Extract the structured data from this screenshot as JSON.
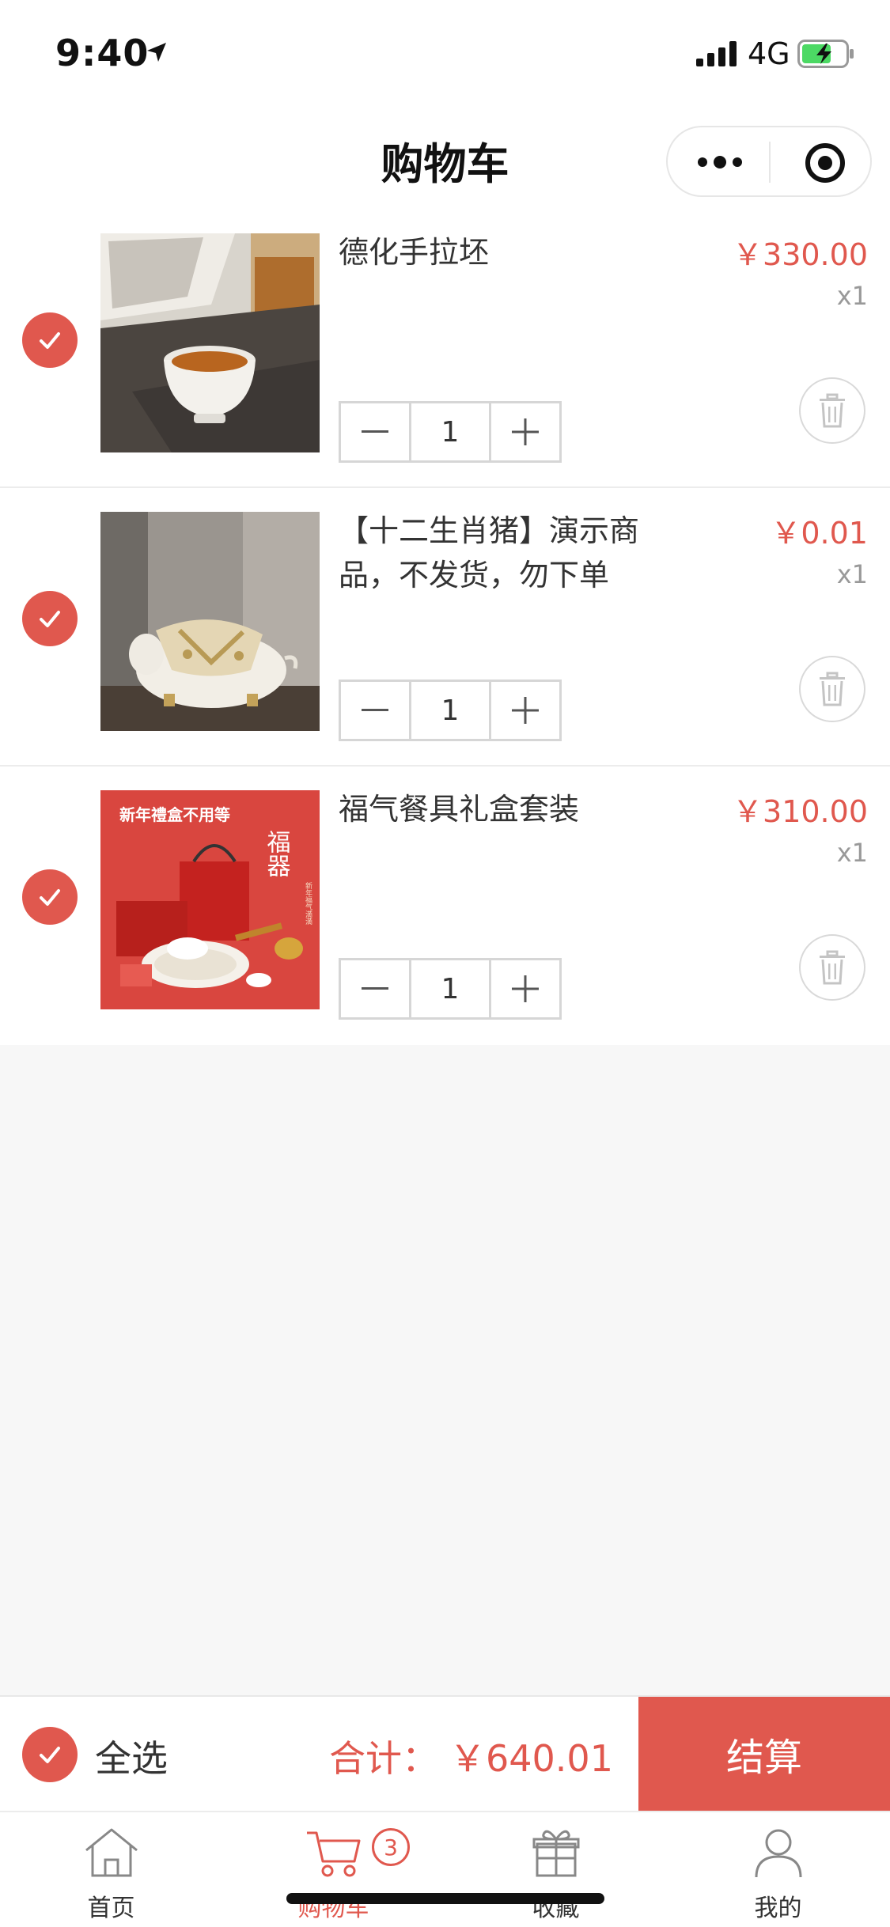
{
  "status_bar": {
    "time": "9:40",
    "network": "4G"
  },
  "nav": {
    "title": "购物车"
  },
  "cart_items": [
    {
      "name": "德化手拉坯",
      "price": "￥330.00",
      "qty_label": "x1",
      "quantity": "1",
      "checked": true
    },
    {
      "name": "【十二生肖猪】演示商品，不发货，勿下单",
      "price": "￥0.01",
      "qty_label": "x1",
      "quantity": "1",
      "checked": true
    },
    {
      "name": "福气餐具礼盒套装",
      "price": "￥310.00",
      "qty_label": "x1",
      "quantity": "1",
      "checked": true
    }
  ],
  "poster": {
    "headline": "新年禮盒不用等",
    "title": "福器",
    "subtitle": "新年福气満満"
  },
  "summary": {
    "select_all_label": "全选",
    "total_label": "合计：",
    "total_value": "￥640.01",
    "checkout_label": "结算"
  },
  "tabs": [
    {
      "label": "首页",
      "icon": "home-icon"
    },
    {
      "label": "购物车",
      "icon": "cart-icon",
      "badge": "3",
      "active": true
    },
    {
      "label": "收藏",
      "icon": "gift-icon"
    },
    {
      "label": "我的",
      "icon": "user-icon"
    }
  ],
  "colors": {
    "accent": "#e0584e",
    "background": "#f7f7f7"
  }
}
